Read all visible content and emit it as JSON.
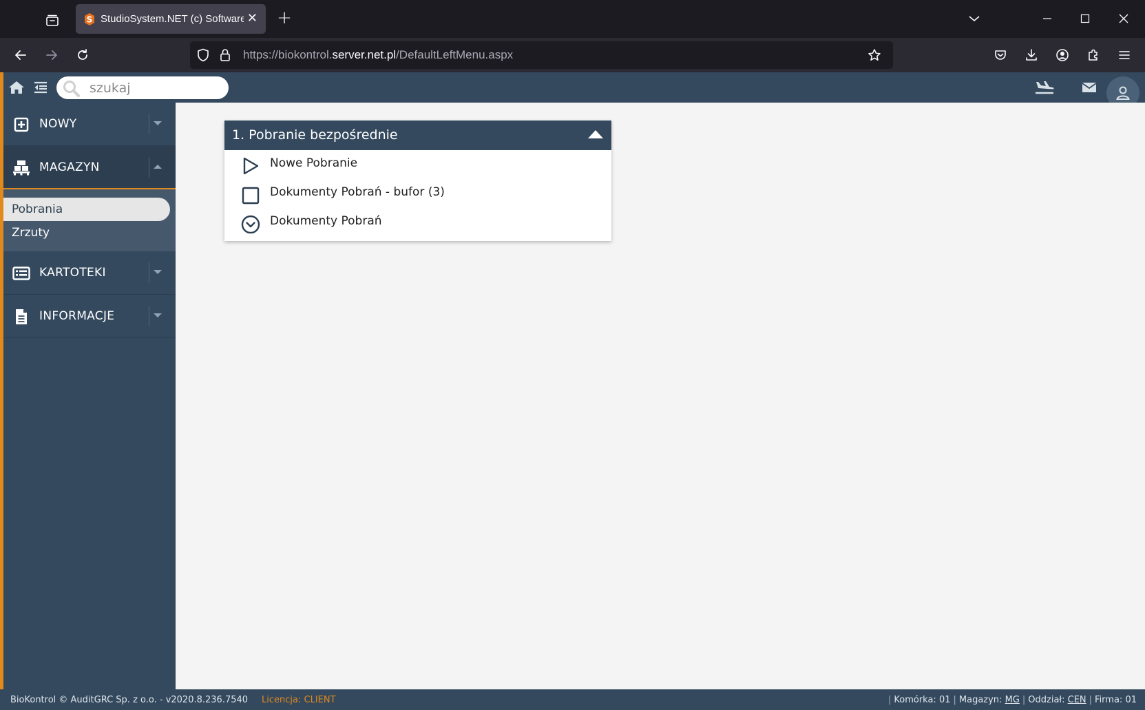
{
  "browser": {
    "tab_title": "StudioSystem.NET (c) SoftwareS",
    "url_prefix": "https://biokontrol.",
    "url_host": "server.net.pl",
    "url_path": "/DefaultLeftMenu.aspx",
    "new_tab_label": "+",
    "tab_close_label": "✕"
  },
  "topbar": {
    "search_placeholder": "szukaj"
  },
  "sidebar": {
    "sections": [
      {
        "label": "NOWY",
        "icon": "plus-square-icon",
        "expanded": false
      },
      {
        "label": "MAGAZYN",
        "icon": "warehouse-pallet-icon",
        "expanded": true
      },
      {
        "label": "KARTOTEKI",
        "icon": "list-card-icon",
        "expanded": false
      },
      {
        "label": "INFORMACJE",
        "icon": "document-icon",
        "expanded": false
      }
    ],
    "magazyn_items": [
      {
        "label": "Pobrania",
        "selected": true
      },
      {
        "label": "Zrzuty",
        "selected": false
      }
    ]
  },
  "panel": {
    "title": "1. Pobranie bezpośrednie",
    "items": [
      {
        "label": "Nowe Pobranie",
        "icon": "play-outline-icon"
      },
      {
        "label": "Dokumenty Pobrań - bufor (3)",
        "icon": "square-outline-icon"
      },
      {
        "label": "Dokumenty Pobrań",
        "icon": "chevron-circle-down-icon"
      }
    ]
  },
  "statusbar": {
    "left": "BioKontrol © AuditGRC Sp. z o.o. - v2020.8.236.7540",
    "license_label": "Licencja:",
    "license_value": "CLIENT",
    "komorka_label": "Komórka:",
    "komorka_value": "01",
    "magazyn_label": "Magazyn:",
    "magazyn_value": "MG",
    "oddzial_label": "Oddział:",
    "oddzial_value": "CEN",
    "firma_label": "Firma:",
    "firma_value": "01"
  },
  "colors": {
    "accent": "#e08a1e",
    "nav_dark": "#34495e",
    "content_bg": "#f4f4f4"
  }
}
